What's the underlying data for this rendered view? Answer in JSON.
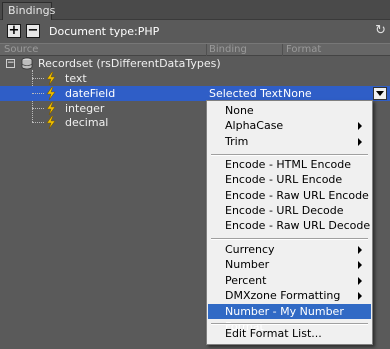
{
  "panel": {
    "tab_label": "Bindings",
    "doc_type": "Document type:PHP",
    "add_label": "+",
    "remove_label": "−",
    "refresh_glyph": "↻"
  },
  "columns": {
    "source": "Source",
    "binding": "Binding",
    "format": "Format"
  },
  "tree": {
    "recordset": "Recordset (rsDifferentDataTypes)",
    "fields": [
      {
        "label": "text",
        "binding": "",
        "format": ""
      },
      {
        "label": "dateField",
        "binding": "Selected Text",
        "format": "None"
      },
      {
        "label": "integer",
        "binding": "",
        "format": ""
      },
      {
        "label": "decimal",
        "binding": "",
        "format": ""
      }
    ]
  },
  "menu": {
    "items": [
      {
        "label": "None",
        "submenu": false
      },
      {
        "label": "AlphaCase",
        "submenu": true
      },
      {
        "label": "Trim",
        "submenu": true
      },
      {
        "label": "Encode - HTML Encode",
        "submenu": false
      },
      {
        "label": "Encode - URL Encode",
        "submenu": false
      },
      {
        "label": "Encode - Raw URL Encode",
        "submenu": false
      },
      {
        "label": "Encode - URL Decode",
        "submenu": false
      },
      {
        "label": "Encode - Raw URL Decode",
        "submenu": false
      },
      {
        "label": "Currency",
        "submenu": true
      },
      {
        "label": "Number",
        "submenu": true
      },
      {
        "label": "Percent",
        "submenu": true
      },
      {
        "label": "DMXzone Formatting",
        "submenu": true
      },
      {
        "label": "Number - My Number Format",
        "submenu": false,
        "highlighted": true
      },
      {
        "label": "Edit Format List...",
        "submenu": false
      }
    ]
  },
  "colors": {
    "panel_bg": "#5a5a5a",
    "selection": "#2f5ec7",
    "menu_highlight": "#316ac5",
    "bolt": "#f5c400"
  }
}
